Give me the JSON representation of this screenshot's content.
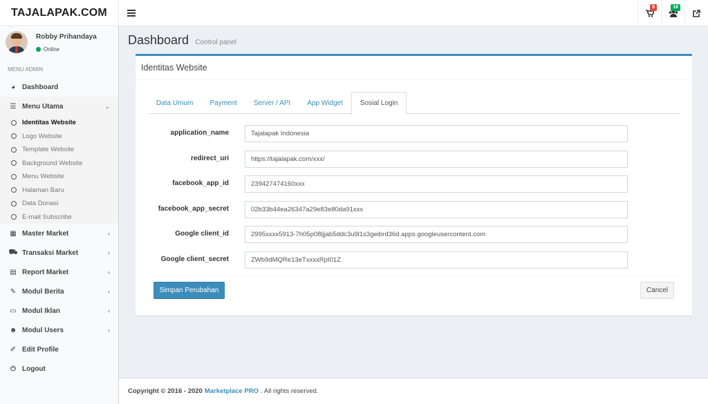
{
  "brand": "TAJALAPAK.COM",
  "topbar": {
    "toggle_icon": "menu-icon",
    "cart_badge": "5",
    "users_badge": "18"
  },
  "sidebar": {
    "user_name": "Robby Prihandaya",
    "user_status": "Online",
    "menu_header": "MENU ADMIN",
    "items": [
      {
        "label": "Dashboard",
        "icon": "dashboard-icon"
      },
      {
        "label": "Menu Utama",
        "icon": "list-icon"
      },
      {
        "label": "Master Market",
        "icon": "grid-icon"
      },
      {
        "label": "Transaksi Market",
        "icon": "cart-icon"
      },
      {
        "label": "Report Market",
        "icon": "book-icon"
      },
      {
        "label": "Modul Berita",
        "icon": "pencil-icon"
      },
      {
        "label": "Modul Iklan",
        "icon": "monitor-icon"
      },
      {
        "label": "Modul Users",
        "icon": "users-icon"
      },
      {
        "label": "Edit Profile",
        "icon": "edit-icon"
      },
      {
        "label": "Logout",
        "icon": "power-icon"
      }
    ],
    "sub_items": [
      "Identitas Website",
      "Logo Website",
      "Template Website",
      "Background Website",
      "Menu Website",
      "Halaman Baru",
      "Data Donasi",
      "E-mail Subscribe"
    ]
  },
  "content": {
    "title": "Dashboard",
    "subtitle": "Control panel",
    "box_title": "Identitas Website",
    "tabs": [
      "Data Umum",
      "Payment",
      "Server / API",
      "App Widget",
      "Sosial Login"
    ],
    "active_tab": "Sosial Login",
    "fields": [
      {
        "label": "application_name",
        "value": "Tajalapak Indonesia"
      },
      {
        "label": "redirect_uri",
        "value": "https://tajalapak.com/xxx/"
      },
      {
        "label": "facebook_app_id",
        "value": "239427474160xxx"
      },
      {
        "label": "facebook_app_secret",
        "value": "02b33b44ea26347a29e83e80da91xxx"
      },
      {
        "label": "Google client_id",
        "value": "2995xxxx5913-7h05p08ljjab5ddc3u9l1s3geibrd36d.apps.googleusercontent.com"
      },
      {
        "label": "Google client_secret",
        "value": "ZWb9dMQRe13eTxxxxRpI01Z"
      }
    ],
    "save_label": "Simpan Perubahan",
    "cancel_label": "Cancel"
  },
  "footer": {
    "prefix": "Copyright © 2016 - 2020",
    "link": "Marketplace PRO",
    "suffix": ". All rights reserved."
  },
  "colors": {
    "primary": "#3c8dbc",
    "online": "#00a65a",
    "badge_red": "#dd4b39",
    "badge_green": "#00a65a"
  }
}
